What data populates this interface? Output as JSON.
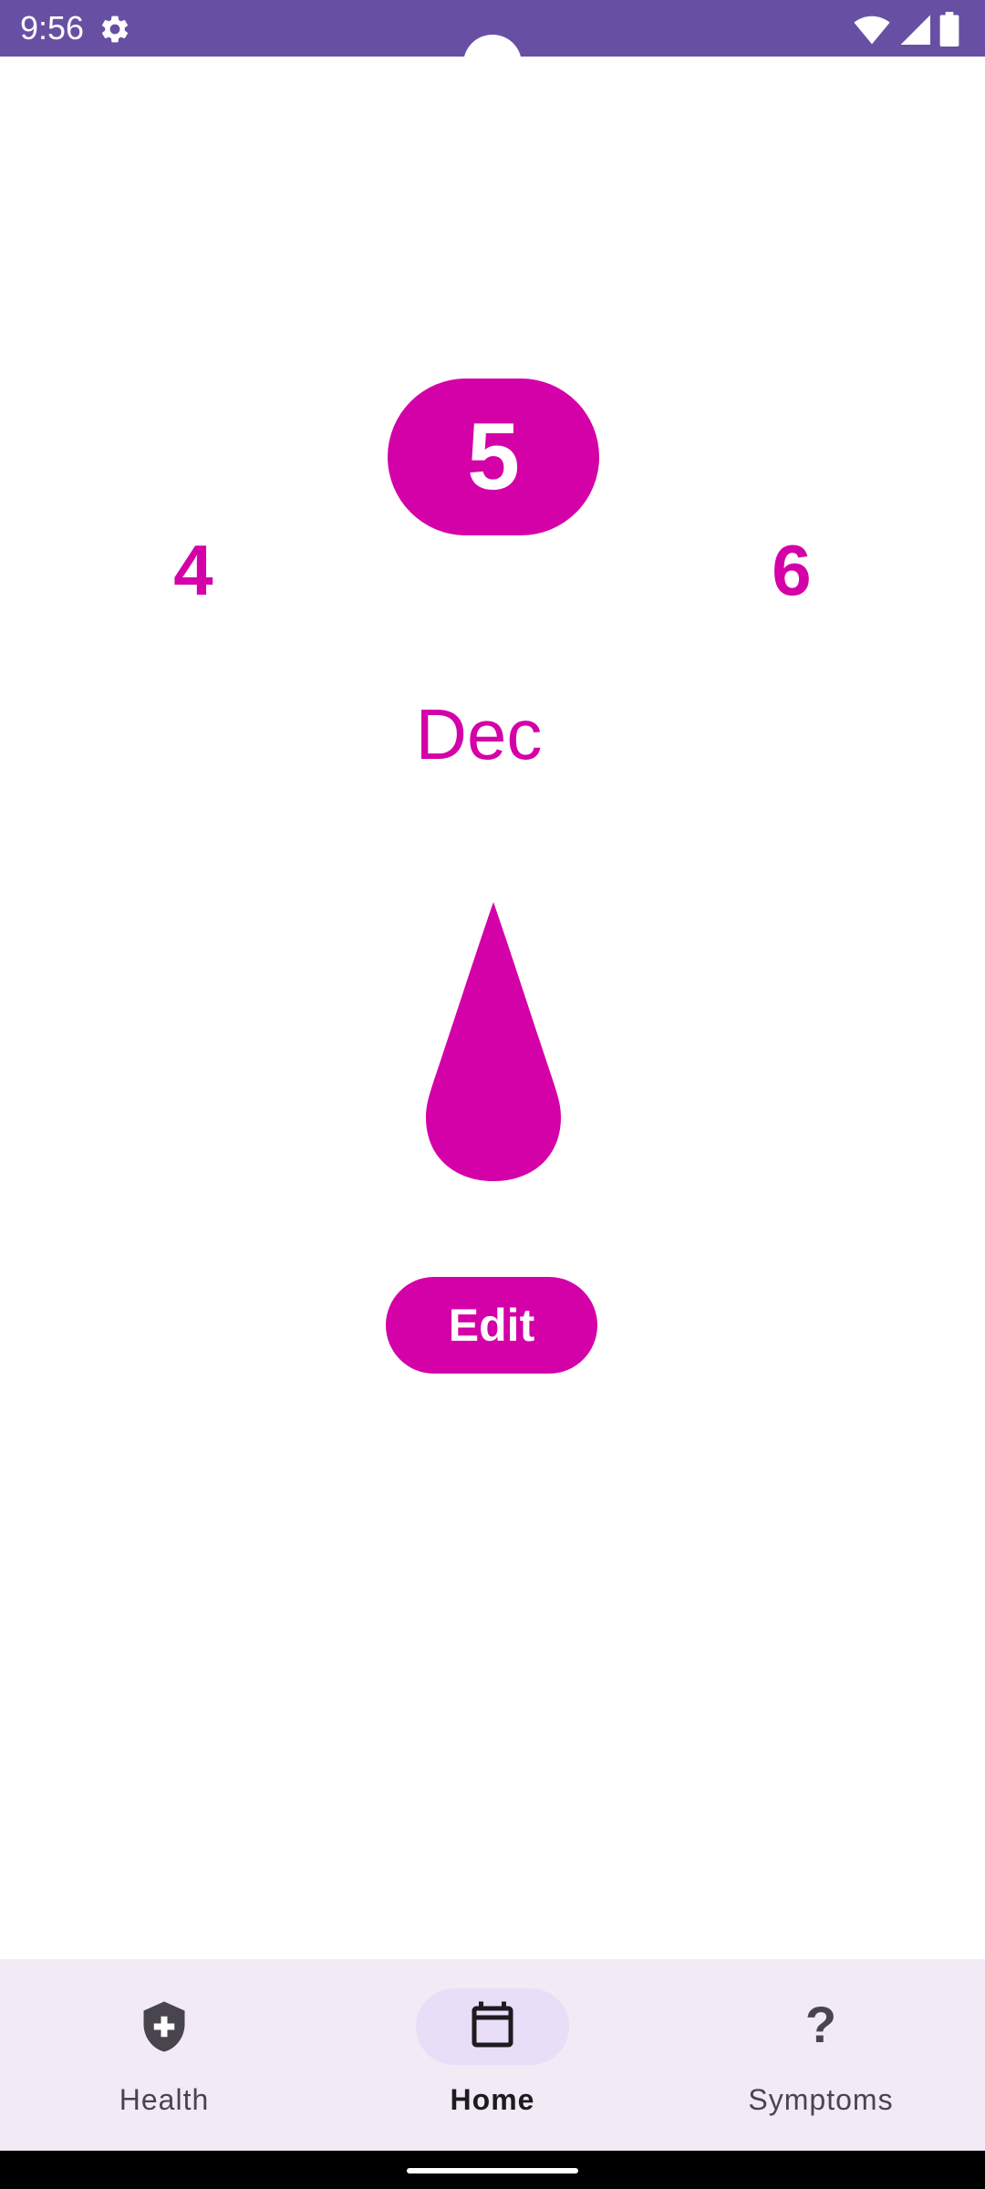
{
  "status_bar": {
    "time": "9:56",
    "background": "#6750a4",
    "icons": [
      "gear-icon",
      "wifi-icon",
      "cell-signal-icon",
      "battery-icon"
    ]
  },
  "date_picker": {
    "previous_day": "4",
    "current_day": "5",
    "next_day": "6",
    "month": "Dec",
    "accent_color": "#d400a8"
  },
  "flow_icon": "blood-drop-icon",
  "edit_button": {
    "label": "Edit"
  },
  "bottom_nav": {
    "items": [
      {
        "label": "Health",
        "icon": "shield-plus-icon",
        "active": false
      },
      {
        "label": "Home",
        "icon": "calendar-icon",
        "active": true
      },
      {
        "label": "Symptoms",
        "icon": "question-mark-icon",
        "active": false
      }
    ],
    "background": "#f2ebf6",
    "indicator_color": "#e8def8"
  },
  "symptoms_glyph": "?"
}
